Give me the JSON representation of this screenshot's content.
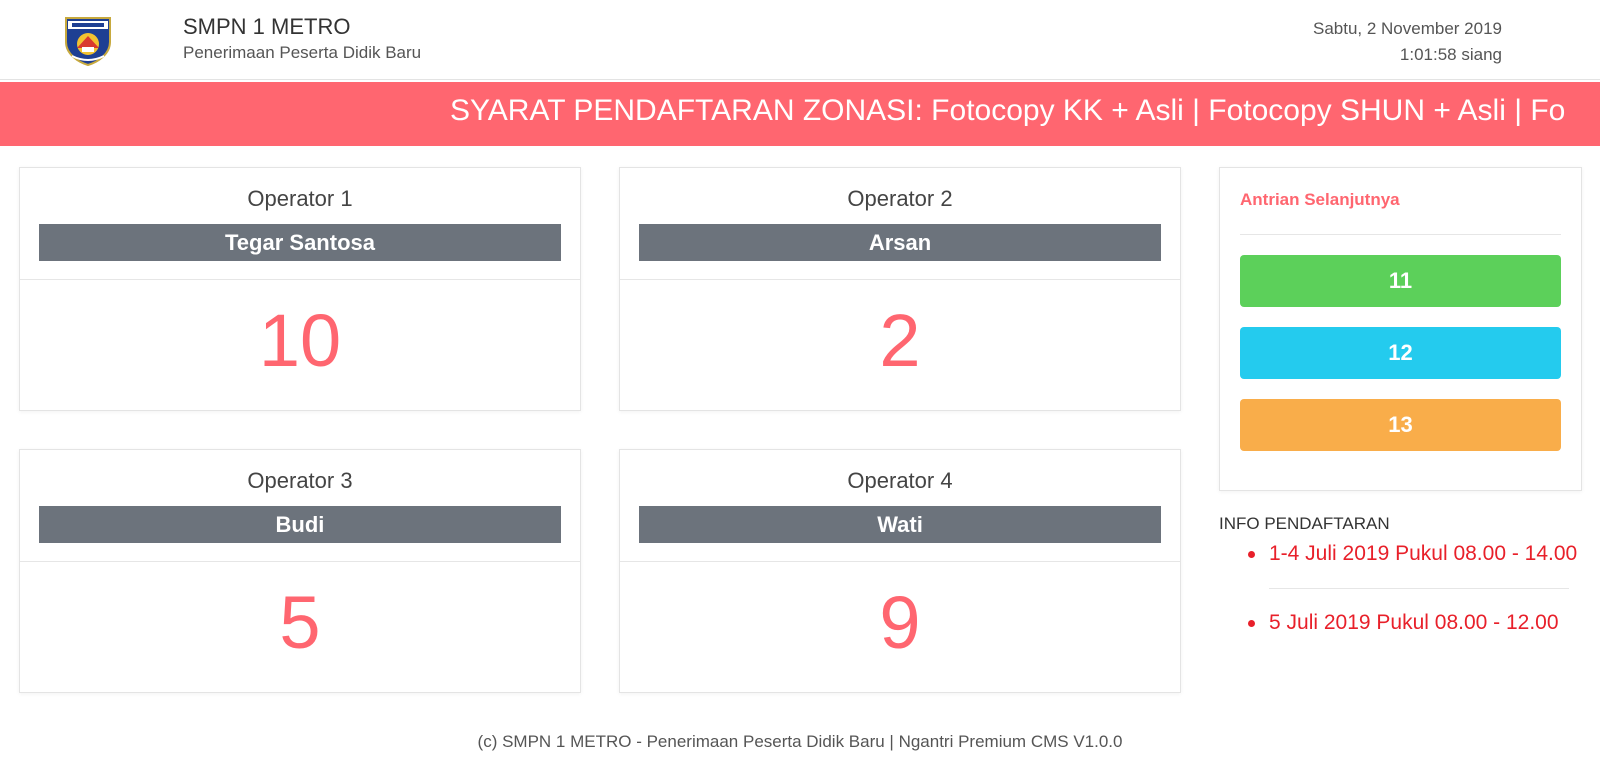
{
  "header": {
    "title": "SMPN 1 METRO",
    "subtitle": "Penerimaan Peserta Didik Baru",
    "logo_icon": "school-shield-logo",
    "date": "Sabtu, 2 November 2019",
    "time": "1:01:58 siang"
  },
  "marquee": {
    "text": "SYARAT PENDAFTARAN ZONASI: Fotocopy KK + Asli | Fotocopy SHUN + Asli | Fo"
  },
  "operators": [
    {
      "title": "Operator 1",
      "name": "Tegar Santosa",
      "number": "10"
    },
    {
      "title": "Operator 2",
      "name": "Arsan",
      "number": "2"
    },
    {
      "title": "Operator 3",
      "name": "Budi",
      "number": "5"
    },
    {
      "title": "Operator 4",
      "name": "Wati",
      "number": "9"
    }
  ],
  "queue": {
    "title": "Antrian Selanjutnya",
    "items": [
      {
        "number": "11",
        "color": "#5cd05a"
      },
      {
        "number": "12",
        "color": "#24cbee"
      },
      {
        "number": "13",
        "color": "#f9ad4a"
      }
    ]
  },
  "info": {
    "title": "INFO PENDAFTARAN",
    "items": [
      "1-4 Juli 2019 Pukul 08.00 - 14.00",
      "5 Juli 2019 Pukul 08.00 - 12.00"
    ]
  },
  "footer": {
    "text": "(c) SMPN 1 METRO - Penerimaan Peserta Didik Baru | Ngantri Premium CMS V1.0.0"
  },
  "colors": {
    "accent": "#ff6670",
    "operator_bar": "#6c737c",
    "info_text": "#e8202a"
  }
}
